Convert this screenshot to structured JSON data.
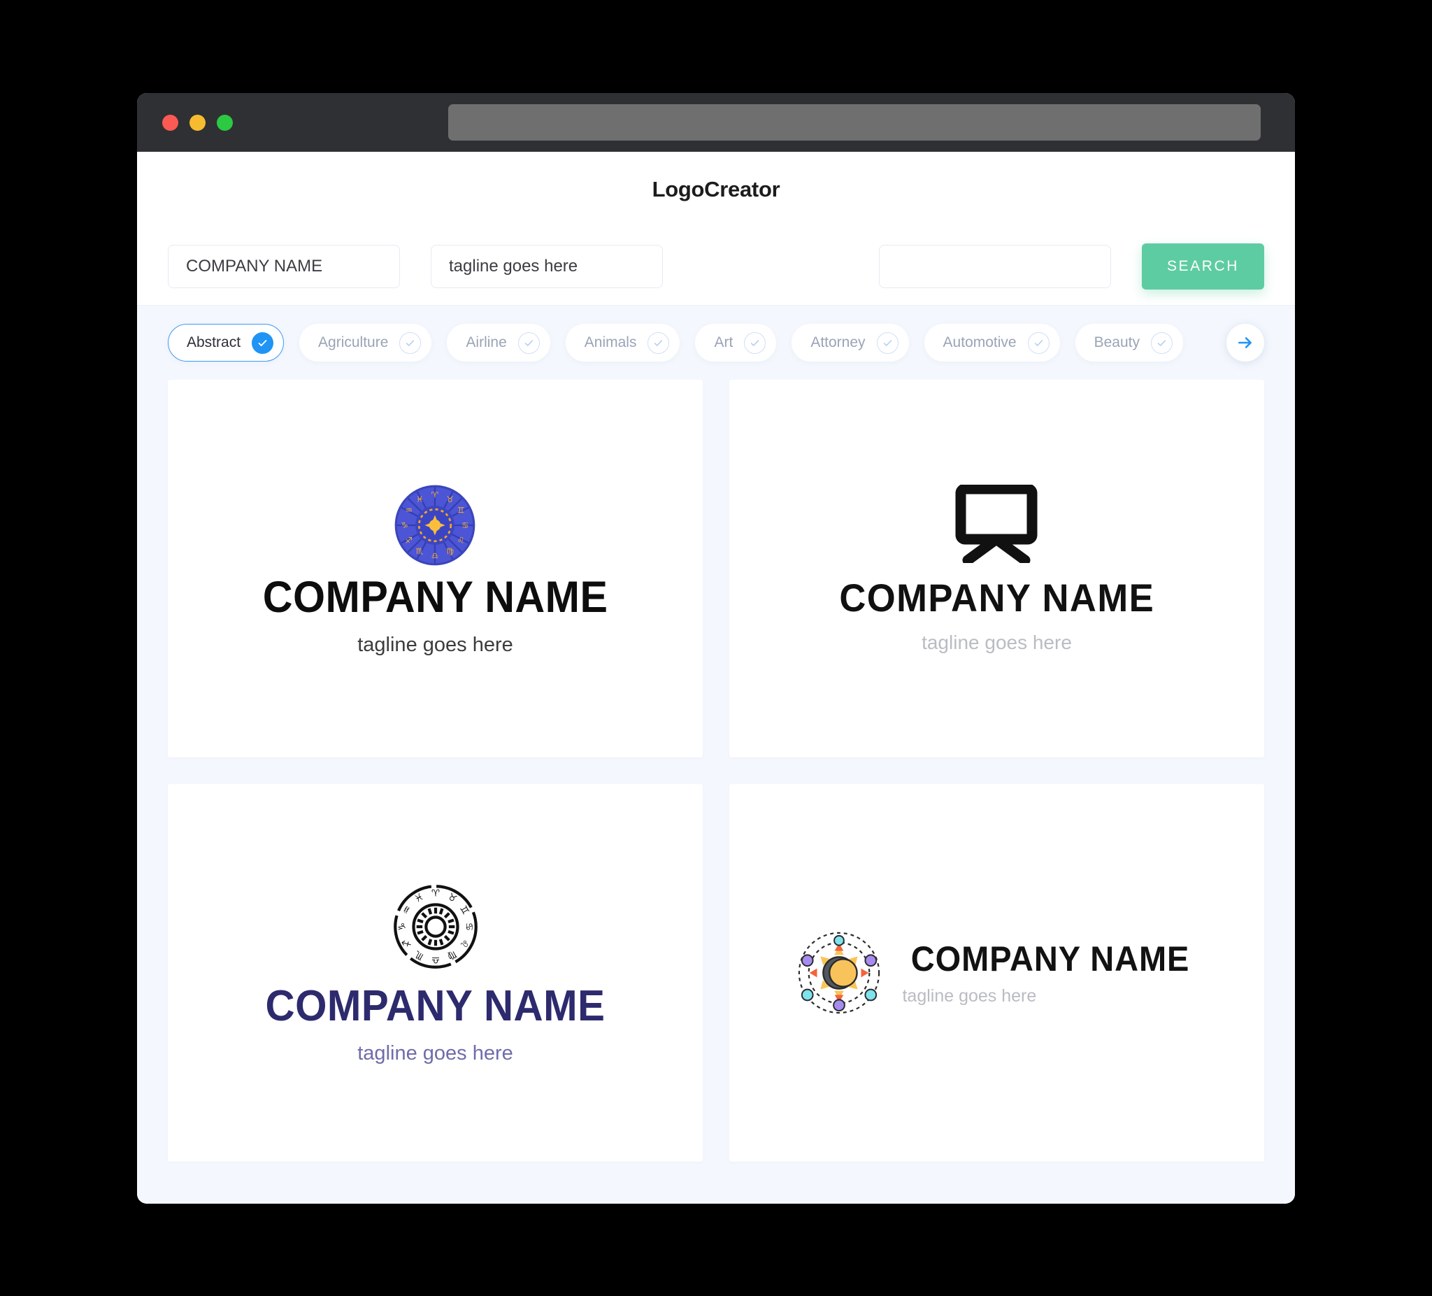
{
  "browser": {
    "traffic_lights": [
      "close",
      "minimize",
      "maximize"
    ],
    "url_value": "",
    "colors": {
      "titlebar": "#2f3033",
      "urlbar": "#6f6f70",
      "red": "#fb5953",
      "yellow": "#f7bb2f",
      "green": "#2bca42"
    }
  },
  "header": {
    "title": "LogoCreator"
  },
  "search": {
    "company_value": "COMPANY NAME",
    "company_placeholder": "COMPANY NAME",
    "tagline_value": "tagline goes here",
    "tagline_placeholder": "tagline goes here",
    "extra_value": "",
    "extra_placeholder": "",
    "button_label": "SEARCH",
    "button_color": "#5ecca2"
  },
  "categories": {
    "accent": "#1f94f5",
    "next_label": "next",
    "items": [
      {
        "label": "Abstract",
        "selected": true
      },
      {
        "label": "Agriculture",
        "selected": false
      },
      {
        "label": "Airline",
        "selected": false
      },
      {
        "label": "Animals",
        "selected": false
      },
      {
        "label": "Art",
        "selected": false
      },
      {
        "label": "Attorney",
        "selected": false
      },
      {
        "label": "Automotive",
        "selected": false
      },
      {
        "label": "Beauty",
        "selected": false
      }
    ]
  },
  "results": {
    "cards": [
      {
        "mark": "zodiac-wheel-color-icon",
        "name": "COMPANY NAME",
        "tagline": "tagline goes here",
        "layout": "stacked",
        "name_color": "#0d0d0d",
        "tagline_color": "#3c3c3c"
      },
      {
        "mark": "easel-board-icon",
        "name": "COMPANY NAME",
        "tagline": "tagline goes here",
        "layout": "stacked",
        "name_color": "#111111",
        "tagline_color": "#b9bcc2"
      },
      {
        "mark": "zodiac-ring-outline-icon",
        "name": "COMPANY NAME",
        "tagline": "tagline goes here",
        "layout": "stacked",
        "name_color": "#2d2a6e",
        "tagline_color": "#6f6cab"
      },
      {
        "mark": "eclipse-orbit-icon",
        "name": "COMPANY NAME",
        "tagline": "tagline goes here",
        "layout": "horizontal",
        "name_color": "#121212",
        "tagline_color": "#b9bcc2"
      }
    ]
  }
}
